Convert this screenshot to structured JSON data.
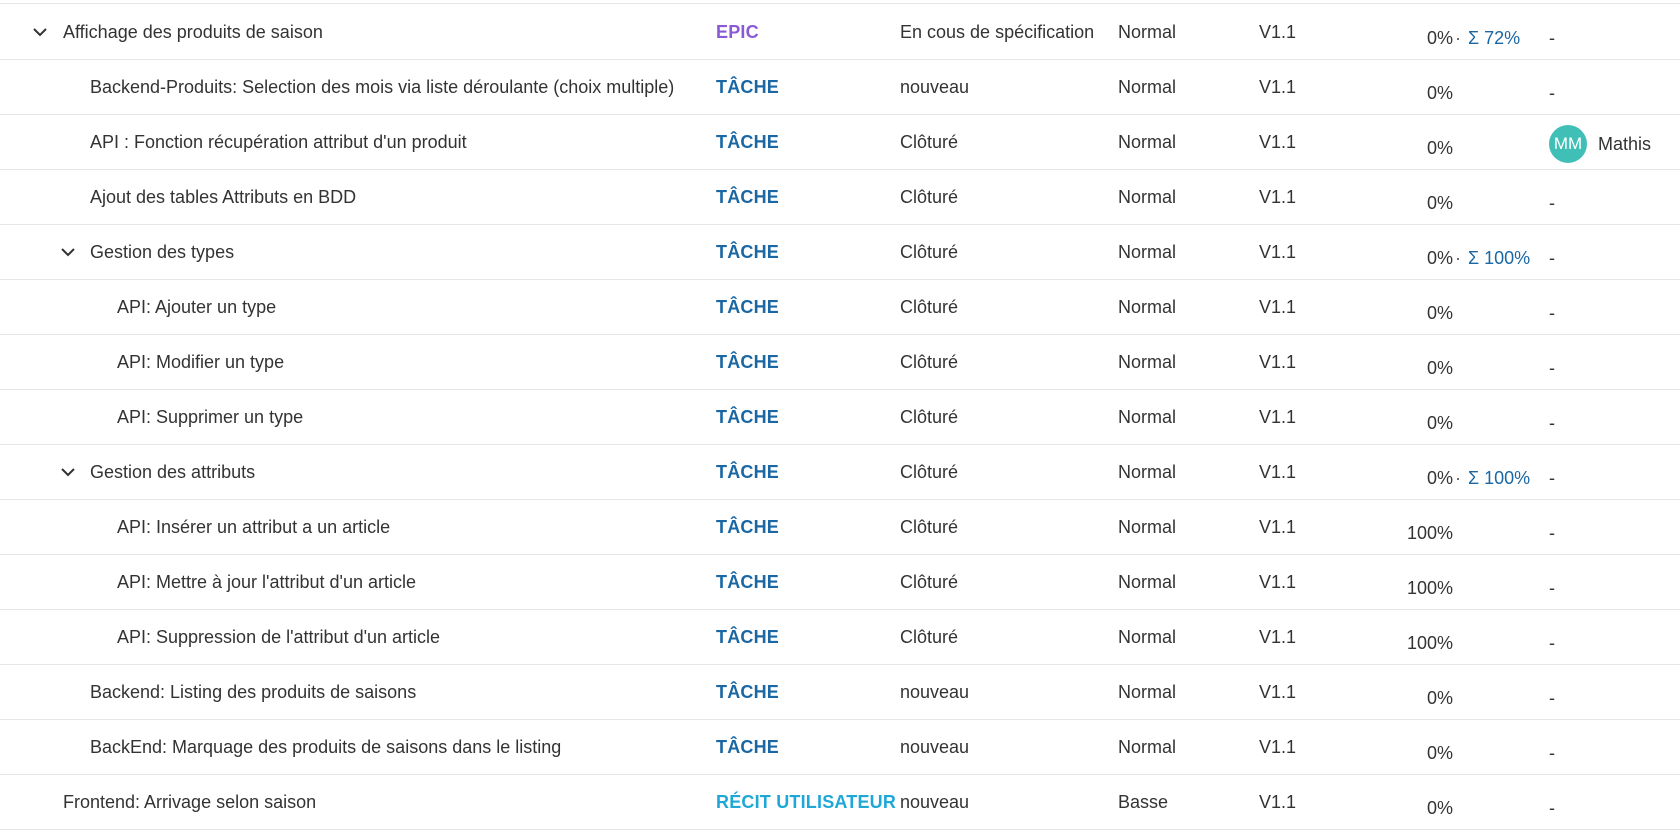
{
  "colors": {
    "epic": "#8a5ad6",
    "task": "#1a67a3",
    "user_story": "#1fa8d6",
    "sum_link": "#1a67a3",
    "avatar_bg": "#3fbfb5",
    "border": "#e6e6e6",
    "text": "#333333"
  },
  "icons": {
    "expand": "chevron-down-icon"
  },
  "rows": [
    {
      "subject": "Affichage des produits de saison",
      "level": 0,
      "expanded": true,
      "type": "EPIC",
      "type_kind": "epic",
      "status": "En cous de spécification",
      "priority": "Normal",
      "version": "V1.1",
      "progress": "0%",
      "sum": "Σ 72%",
      "assignee": "-"
    },
    {
      "subject": "Backend-Produits: Selection des mois via liste déroulante (choix multiple)",
      "level": 1,
      "type": "TÂCHE",
      "type_kind": "task",
      "status": "nouveau",
      "priority": "Normal",
      "version": "V1.1",
      "progress": "0%",
      "assignee": "-"
    },
    {
      "subject": "API : Fonction récupération attribut d'un produit",
      "level": 1,
      "type": "TÂCHE",
      "type_kind": "task",
      "status": "Clôturé",
      "priority": "Normal",
      "version": "V1.1",
      "progress": "0%",
      "assignee_user": {
        "initials": "MM",
        "name": "Mathis"
      }
    },
    {
      "subject": "Ajout des tables Attributs en BDD",
      "level": 1,
      "type": "TÂCHE",
      "type_kind": "task",
      "status": "Clôturé",
      "priority": "Normal",
      "version": "V1.1",
      "progress": "0%",
      "assignee": "-"
    },
    {
      "subject": "Gestion des types",
      "level": 1,
      "expanded": true,
      "type": "TÂCHE",
      "type_kind": "task",
      "status": "Clôturé",
      "priority": "Normal",
      "version": "V1.1",
      "progress": "0%",
      "sum": "Σ 100%",
      "assignee": "-"
    },
    {
      "subject": "API: Ajouter un type",
      "level": 2,
      "type": "TÂCHE",
      "type_kind": "task",
      "status": "Clôturé",
      "priority": "Normal",
      "version": "V1.1",
      "progress": "0%",
      "assignee": "-"
    },
    {
      "subject": "API: Modifier un type",
      "level": 2,
      "type": "TÂCHE",
      "type_kind": "task",
      "status": "Clôturé",
      "priority": "Normal",
      "version": "V1.1",
      "progress": "0%",
      "assignee": "-"
    },
    {
      "subject": "API: Supprimer un type",
      "level": 2,
      "type": "TÂCHE",
      "type_kind": "task",
      "status": "Clôturé",
      "priority": "Normal",
      "version": "V1.1",
      "progress": "0%",
      "assignee": "-"
    },
    {
      "subject": "Gestion des attributs",
      "level": 1,
      "expanded": true,
      "type": "TÂCHE",
      "type_kind": "task",
      "status": "Clôturé",
      "priority": "Normal",
      "version": "V1.1",
      "progress": "0%",
      "sum": "Σ 100%",
      "assignee": "-"
    },
    {
      "subject": "API: Insérer un attribut a un article",
      "level": 2,
      "type": "TÂCHE",
      "type_kind": "task",
      "status": "Clôturé",
      "priority": "Normal",
      "version": "V1.1",
      "progress": "100%",
      "assignee": "-"
    },
    {
      "subject": "API: Mettre à jour l'attribut d'un article",
      "level": 2,
      "type": "TÂCHE",
      "type_kind": "task",
      "status": "Clôturé",
      "priority": "Normal",
      "version": "V1.1",
      "progress": "100%",
      "assignee": "-"
    },
    {
      "subject": "API: Suppression de l'attribut d'un article",
      "level": 2,
      "type": "TÂCHE",
      "type_kind": "task",
      "status": "Clôturé",
      "priority": "Normal",
      "version": "V1.1",
      "progress": "100%",
      "assignee": "-"
    },
    {
      "subject": "Backend: Listing des produits de saisons",
      "level": 1,
      "type": "TÂCHE",
      "type_kind": "task",
      "status": "nouveau",
      "priority": "Normal",
      "version": "V1.1",
      "progress": "0%",
      "assignee": "-"
    },
    {
      "subject": "BackEnd: Marquage des produits de saisons dans le listing",
      "level": 1,
      "type": "TÂCHE",
      "type_kind": "task",
      "status": "nouveau",
      "priority": "Normal",
      "version": "V1.1",
      "progress": "0%",
      "assignee": "-"
    },
    {
      "subject": "Frontend: Arrivage selon saison",
      "level": 0,
      "type": "RÉCIT UTILISATEUR",
      "type_kind": "user_story",
      "status": "nouveau",
      "priority": "Basse",
      "version": "V1.1",
      "progress": "0%",
      "assignee": "-"
    }
  ]
}
